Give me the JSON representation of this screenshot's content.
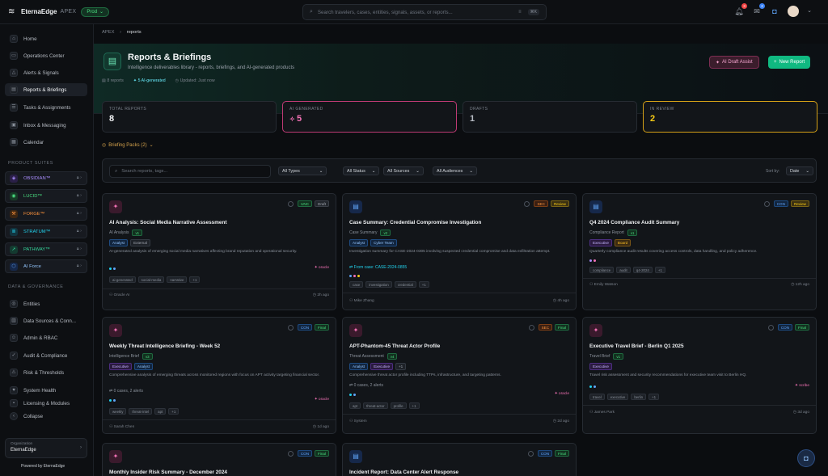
{
  "topbar": {
    "brand": "EternaEdge",
    "brand_sub": "APEX",
    "env": "Prod",
    "search_placeholder": "Search travelers, cases, entities, signals, assets, or reports...",
    "kbd": "⌘K",
    "alerts_count": "3",
    "messages_count": "2"
  },
  "sidebar": {
    "nav": [
      {
        "label": "Home",
        "icon": "home-icon"
      },
      {
        "label": "Operations Center",
        "icon": "monitor-icon"
      },
      {
        "label": "Alerts & Signals",
        "icon": "alert-icon"
      },
      {
        "label": "Reports & Briefings",
        "icon": "report-icon"
      },
      {
        "label": "Tasks & Assignments",
        "icon": "tasks-icon"
      },
      {
        "label": "Inbox & Messaging",
        "icon": "inbox-icon"
      },
      {
        "label": "Calendar",
        "icon": "calendar-icon"
      }
    ],
    "suites_title": "Product Suites",
    "suites": [
      {
        "label": "OBSIDIAN™",
        "color": "#a78bfa"
      },
      {
        "label": "LUCID™",
        "color": "#4ade80"
      },
      {
        "label": "FORGE™",
        "color": "#fb923c"
      },
      {
        "label": "STRATUM™",
        "color": "#22d3ee"
      },
      {
        "label": "PATHWAY™",
        "color": "#34d399"
      },
      {
        "label": "AI Force",
        "color": "#60a5fa"
      }
    ],
    "gov_title": "Data & Governance",
    "gov": [
      {
        "label": "Entities"
      },
      {
        "label": "Data Sources & Conn..."
      },
      {
        "label": "Admin & RBAC"
      },
      {
        "label": "Audit & Compliance"
      },
      {
        "label": "Risk & Thresholds"
      },
      {
        "label": "System Health"
      },
      {
        "label": "Licensing & Modules"
      }
    ],
    "collapse": "Collapse",
    "org_label": "Organization",
    "org_name": "EternaEdge",
    "powered": "Powered by EternaEdge"
  },
  "breadcrumb": {
    "root": "APEX",
    "current": "reports"
  },
  "header": {
    "title": "Reports & Briefings",
    "subtitle": "Intelligence deliverables library - reports, briefings, and AI-generated products",
    "meta_reports": "8 reports",
    "meta_ai": "5 AI-generated",
    "meta_updated": "Updated: Just now",
    "btn_ai": "AI Draft Assist",
    "btn_new": "New Report"
  },
  "stats": [
    {
      "label": "Total Reports",
      "value": "8"
    },
    {
      "label": "AI Generated",
      "value": "5"
    },
    {
      "label": "Drafts",
      "value": "1"
    },
    {
      "label": "In Review",
      "value": "2"
    }
  ],
  "briefing_packs": "Briefing Packs (2)",
  "filters": {
    "search_placeholder": "Search reports, tags...",
    "types": "All Types",
    "status": "All Status",
    "sources": "All Sources",
    "audiences": "All Audiences",
    "sort_label": "Sort by:",
    "sort_value": "Date"
  },
  "cards": [
    {
      "title": "AI Analysis: Social Media Narrative Assessment",
      "type": "AI Analysis",
      "version": "v1",
      "class": "UNC",
      "status": "Draft",
      "audiences": [
        "Analyst",
        "External"
      ],
      "desc": "AI-generated analysis of emerging social media narratives affecting brand reputation and operational security.",
      "link": "",
      "engine": "oracle",
      "tags": [
        "ai-generated",
        "social-media",
        "narrative",
        "+1"
      ],
      "author": "Oracle AI",
      "ago": "2h ago"
    },
    {
      "title": "Case Summary: Credential Compromise Investigation",
      "type": "Case Summary",
      "version": "v2",
      "class": "SEC",
      "status": "Review",
      "audiences": [
        "Analyst",
        "Cyber Team"
      ],
      "desc": "Investigation summary for CASE-2024-0305 involving suspected credential compromise and data exfiltration attempt.",
      "link": "From case: CASE-2024-0855",
      "engine": "",
      "tags": [
        "case",
        "investigation",
        "credential",
        "+1"
      ],
      "author": "Mike Zhang",
      "ago": "4h ago"
    },
    {
      "title": "Q4 2024 Compliance Audit Summary",
      "type": "Compliance Report",
      "version": "v1",
      "class": "CON",
      "status": "Review",
      "audiences": [
        "Executive",
        "Board"
      ],
      "desc": "Quarterly compliance audit results covering access controls, data handling, and policy adherence.",
      "link": "",
      "engine": "",
      "tags": [
        "compliance",
        "audit",
        "q4-2024",
        "+1"
      ],
      "author": "Emily Watson",
      "ago": "12h ago"
    },
    {
      "title": "Weekly Threat Intelligence Briefing - Week 52",
      "type": "Intelligence Brief",
      "version": "v3",
      "class": "CON",
      "status": "Final",
      "audiences": [
        "Executive",
        "Analyst"
      ],
      "desc": "Comprehensive analysis of emerging threats across monitored regions with focus on APT activity targeting financial sector.",
      "link": "0 cases, 2 alerts",
      "engine": "oracle",
      "tags": [
        "weekly",
        "threat-intel",
        "apt",
        "+1"
      ],
      "author": "Sarah Chen",
      "ago": "1d ago"
    },
    {
      "title": "APT-Phantom-45 Threat Actor Profile",
      "type": "Threat Assessment",
      "version": "v4",
      "class": "SEC",
      "status": "Final",
      "audiences": [
        "Analyst",
        "Executive",
        "+1"
      ],
      "desc": "Comprehensive threat actor profile including TTPs, infrastructure, and targeting patterns.",
      "link": "0 cases, 2 alerts",
      "engine": "oracle",
      "tags": [
        "apt",
        "threat-actor",
        "profile",
        "+1"
      ],
      "author": "System",
      "ago": "2d ago"
    },
    {
      "title": "Executive Travel Brief - Berlin Q1 2025",
      "type": "Travel Brief",
      "version": "v1",
      "class": "CON",
      "status": "Final",
      "audiences": [
        "Executive"
      ],
      "desc": "Travel risk assessment and security recommendations for executive team visit to Berlin HQ.",
      "link": "",
      "engine": "scribe",
      "tags": [
        "travel",
        "executive",
        "berlin",
        "+1"
      ],
      "author": "James Park",
      "ago": "3d ago"
    },
    {
      "title": "Monthly Insider Risk Summary - December 2024",
      "type": "",
      "version": "",
      "class": "CON",
      "status": "Final",
      "audiences": [],
      "desc": "",
      "link": "",
      "engine": "",
      "tags": [],
      "author": "",
      "ago": ""
    },
    {
      "title": "Incident Report: Data Center Alert Response",
      "type": "",
      "version": "",
      "class": "CON",
      "status": "Final",
      "audiences": [],
      "desc": "",
      "link": "",
      "engine": "",
      "tags": [],
      "author": "",
      "ago": ""
    }
  ]
}
